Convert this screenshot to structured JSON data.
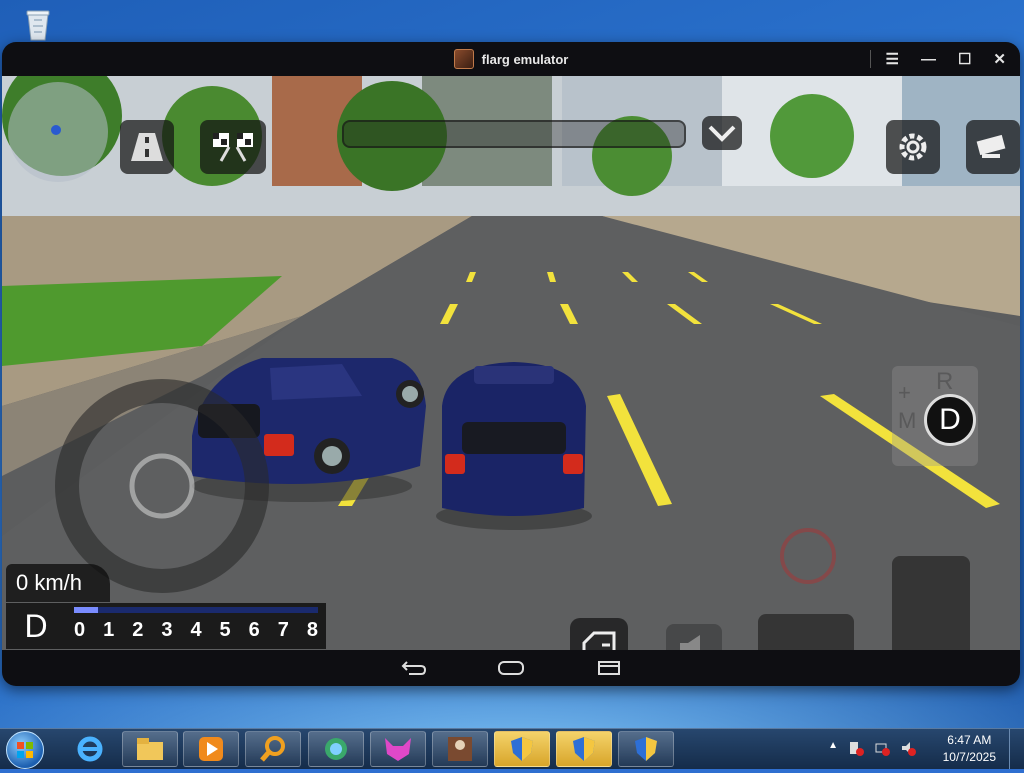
{
  "window": {
    "title": "flarg emulator"
  },
  "desktop": {
    "recycle_bin_icon": "recycle-bin-icon"
  },
  "hud": {
    "speed": "0 km/h",
    "gear": "D",
    "rpm_ticks": [
      "0",
      "1",
      "2",
      "3",
      "4",
      "5",
      "6",
      "7",
      "8"
    ],
    "rpm_level": 0.1,
    "shift_gear": "D",
    "shift_options": [
      "R",
      "+",
      "M"
    ]
  },
  "taskbar": {
    "time": "6:47 AM",
    "date": "10/7/2025",
    "apps": [
      "explorer",
      "media-player",
      "search-magnifier",
      "browser-globe",
      "fox-app",
      "flarg-emulator",
      "uac-shield",
      "uac-shield",
      "uac-shield"
    ]
  },
  "colors": {
    "accent": "#1f5fb8",
    "car": "#1a2466",
    "lane": "#f2e23c"
  }
}
